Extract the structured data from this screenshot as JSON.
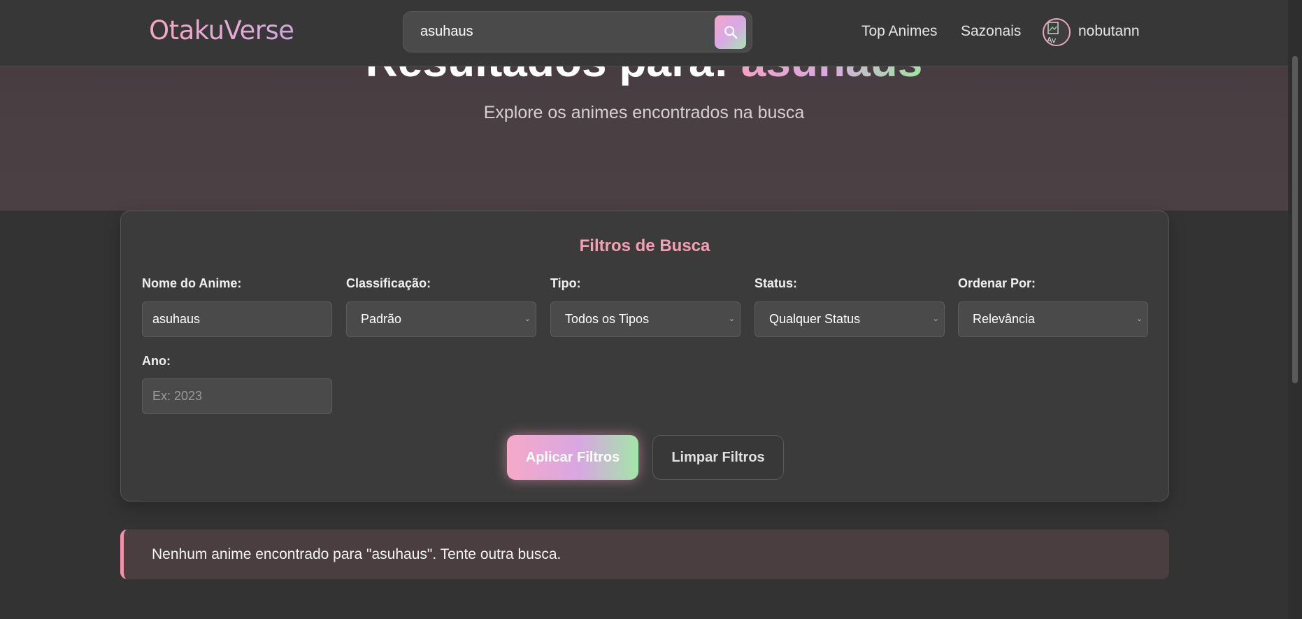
{
  "header": {
    "logo": "OtakuVerse",
    "search_value": "asuhaus",
    "nav": [
      "Top Animes",
      "Sazonais"
    ],
    "username": "nobutann",
    "avatar_alt": "Av"
  },
  "hero": {
    "title_prefix": "Resultados para: ",
    "query": "asuhaus",
    "subtitle": "Explore os animes encontrados na busca"
  },
  "filters": {
    "title": "Filtros de Busca",
    "name_label": "Nome do Anime:",
    "name_value": "asuhaus",
    "classification_label": "Classificação:",
    "classification_value": "Padrão",
    "type_label": "Tipo:",
    "type_value": "Todos os Tipos",
    "status_label": "Status:",
    "status_value": "Qualquer Status",
    "order_label": "Ordenar Por:",
    "order_value": "Relevância",
    "year_label": "Ano:",
    "year_placeholder": "Ex: 2023",
    "apply_label": "Aplicar Filtros",
    "clear_label": "Limpar Filtros"
  },
  "alert": {
    "message": "Nenhum anime encontrado para \"asuhaus\". Tente outra busca."
  },
  "colors": {
    "accent_pink": "#f2a0b6",
    "accent_green": "#9fe6a5",
    "background": "#333333"
  }
}
